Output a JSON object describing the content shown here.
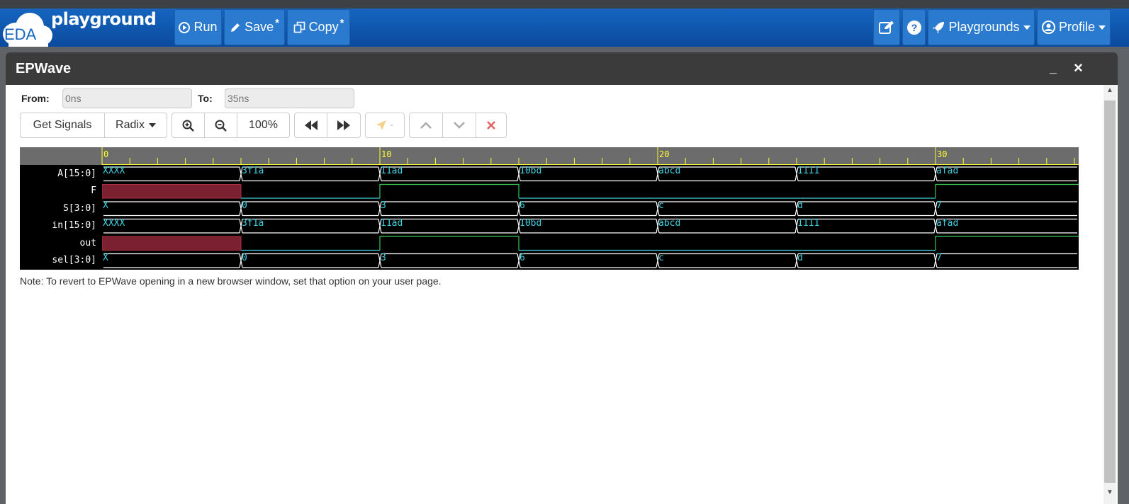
{
  "navbar": {
    "logo_text": "playground",
    "logo_sub": "EDA",
    "run_label": "Run",
    "save_label": "Save",
    "copy_label": "Copy",
    "modified_mark": "*",
    "playgrounds_label": "Playgrounds",
    "profile_label": "Profile"
  },
  "modal": {
    "title": "EPWave",
    "minimize": "_",
    "close": "×"
  },
  "range": {
    "from_label": "From:",
    "from_value": "0ns",
    "to_label": "To:",
    "to_value": "35ns"
  },
  "toolbar": {
    "get_signals": "Get Signals",
    "radix": "Radix",
    "zoom_level": "100%",
    "cursor_marker": "-"
  },
  "wave": {
    "ruler_labels": [
      "0",
      "10",
      "20",
      "30"
    ],
    "signals": [
      {
        "name": "A[15:0]",
        "values": [
          "XXXX",
          "3f1a",
          "11ad",
          "10bd",
          "abcd",
          "1111",
          "afad"
        ]
      },
      {
        "name": "F",
        "values": []
      },
      {
        "name": "S[3:0]",
        "values": [
          "X",
          "0",
          "3",
          "6",
          "c",
          "d",
          "7"
        ]
      },
      {
        "name": "in[15:0]",
        "values": [
          "XXXX",
          "3f1a",
          "11ad",
          "10bd",
          "abcd",
          "1111",
          "afad"
        ]
      },
      {
        "name": "out",
        "values": []
      },
      {
        "name": "sel[3:0]",
        "values": [
          "X",
          "0",
          "3",
          "6",
          "c",
          "d",
          "7"
        ]
      }
    ]
  },
  "note": "Note: To revert to EPWave opening in a new browser window, set that option on your user page.",
  "colors": {
    "navbar": "#1565c0",
    "wave_value": "#3fd0e0",
    "wave_high": "#33cc55",
    "wave_undefined": "#7a2030",
    "ruler_tick": "#ffff33"
  }
}
